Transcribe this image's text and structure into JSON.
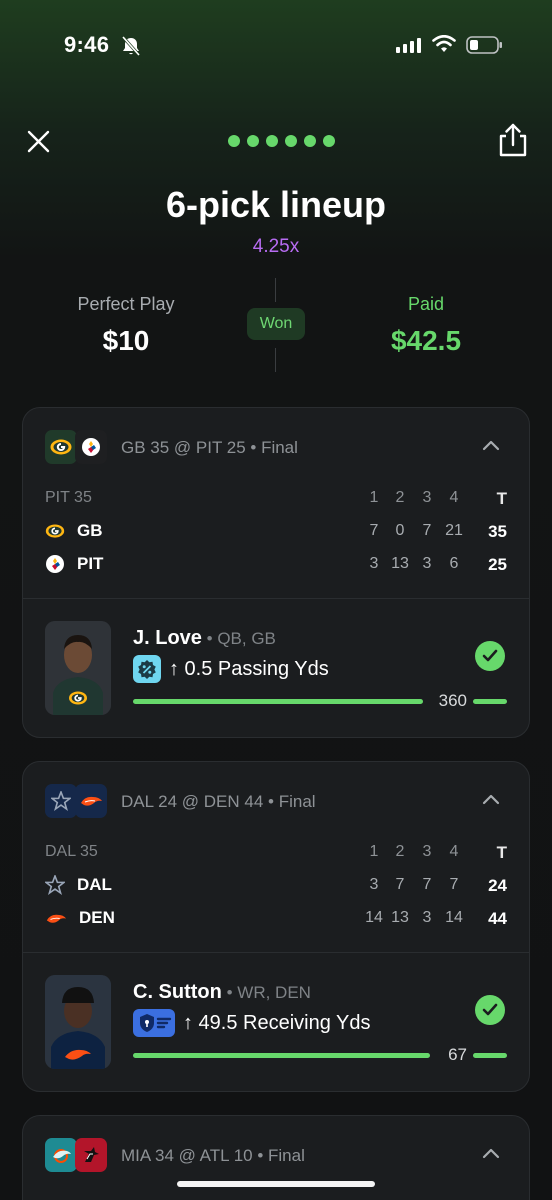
{
  "status": {
    "time": "9:46",
    "icons": [
      "bell-slash-icon",
      "signal-icon",
      "wifi-icon",
      "battery-icon"
    ]
  },
  "header": {
    "title": "6-pick lineup",
    "multiplier": "4.25x",
    "page_dots": 6
  },
  "summary": {
    "left_label": "Perfect Play",
    "left_value": "$10",
    "badge": "Won",
    "right_label": "Paid",
    "right_value": "$42.5"
  },
  "colors": {
    "accent": "#67d86b",
    "multiplier": "#b76cf2",
    "background": "#111213"
  },
  "cards": [
    {
      "game": "GB 35 @ PIT 25 • Final",
      "sb_label": "PIT 35",
      "quarters": [
        "1",
        "2",
        "3",
        "4"
      ],
      "total_label": "T",
      "teams": [
        {
          "abbr": "GB",
          "scores": [
            "7",
            "0",
            "7",
            "21"
          ],
          "total": "35"
        },
        {
          "abbr": "PIT",
          "scores": [
            "3",
            "13",
            "3",
            "6"
          ],
          "total": "25"
        }
      ],
      "player": {
        "name": "J. Love",
        "pos": " • QB, GB",
        "pick": "↑ 0.5 Passing Yds",
        "result": "360",
        "progress": 0.88
      }
    },
    {
      "game": "DAL 24 @ DEN 44 • Final",
      "sb_label": "DAL 35",
      "quarters": [
        "1",
        "2",
        "3",
        "4"
      ],
      "total_label": "T",
      "teams": [
        {
          "abbr": "DAL",
          "scores": [
            "3",
            "7",
            "7",
            "7"
          ],
          "total": "24"
        },
        {
          "abbr": "DEN",
          "scores": [
            "14",
            "13",
            "3",
            "14"
          ],
          "total": "44"
        }
      ],
      "player": {
        "name": "C. Sutton",
        "pos": " • WR, DEN",
        "pick": "↑ 49.5 Receiving Yds",
        "result": "67",
        "progress": 0.9
      }
    },
    {
      "game": "MIA 34 @ ATL 10 • Final"
    }
  ]
}
